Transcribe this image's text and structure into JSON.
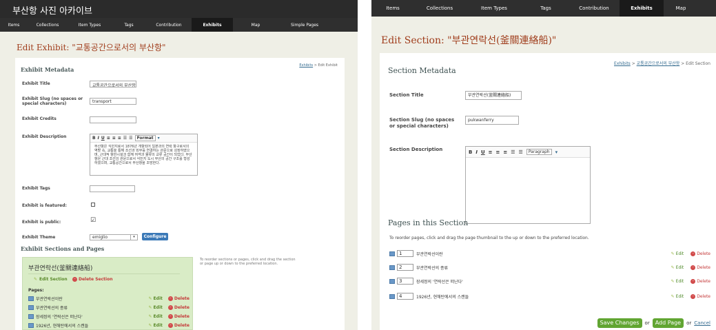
{
  "left": {
    "site_title": "부산항 사진 아카이브",
    "nav": [
      "Items",
      "Collections",
      "Item Types",
      "Tags",
      "Contribution",
      "Exhibits",
      "Map",
      "Simple Pages"
    ],
    "active_nav": "Exhibits",
    "page_title": "Edit Exhibit: \"교통공간으로서의 부산항\"",
    "breadcrumb_link": "Exhibits",
    "breadcrumb_rest": "> Edit Exhibit",
    "metadata_heading": "Exhibit Metadata",
    "fields": {
      "title_label": "Exhibit Title",
      "title_value": "교통공간으로서의 부산항",
      "slug_label": "Exhibit Slug (no spaces or special characters)",
      "slug_value": "transport",
      "credits_label": "Exhibit Credits",
      "credits_value": "",
      "description_label": "Exhibit Description",
      "description_text": "부산항은 식민지로서 1876년 개항되어 일본과의 연락 항구로서의 역할 속, 교통을 통해 조선과 외부를 연결하는 관문으로 성장하였으며, 근대적 항만시설과 함께 여객과 물류의 교류 공간이 되었다. 부산항은 근대 조선의 관문으로서 식민지 도시 부산의 공간 구조를 형성하였으며, 교통공간으로서 부산항을 조망한다.",
      "format_label": "Format",
      "tags_label": "Exhibit Tags",
      "tags_value": "",
      "featured_label": "Exhibit is featured:",
      "featured_mark": "",
      "public_label": "Exhibit is public:",
      "public_mark": "☑",
      "theme_label": "Exhibit Theme",
      "theme_value": "emiglio",
      "configure_label": "Configure"
    },
    "sections_heading": "Exhibit Sections and Pages",
    "section_name": "부관연락선(釜關連絡船)",
    "edit_section": "Edit Section",
    "delete_section": "Delete Section",
    "pages_label": "Pages:",
    "pages": [
      "부관연락선이란",
      "부관연락선의 종류",
      "장세정의 '연락선은 떠난다'",
      "1926년, 현해탄에서의 스캔들"
    ],
    "edit_label": "Edit",
    "delete_label": "Delete",
    "reorder_hint": "To reorder sections or pages, click and drag the section or page up or down to the preferred location."
  },
  "right": {
    "nav": [
      "Items",
      "Collections",
      "Item Types",
      "Tags",
      "Contribution",
      "Exhibits",
      "Map"
    ],
    "active_nav": "Exhibits",
    "page_title": "Edit Section: \"부관연락선(釜關連絡船)\"",
    "breadcrumb_link1": "Exhibits",
    "breadcrumb_link2": "교통공간으로서의 부산항",
    "breadcrumb_rest": "> Edit Section",
    "metadata_heading": "Section Metadata",
    "fields": {
      "title_label": "Section Title",
      "title_value": "부관연락선(釜關連絡船)",
      "slug_label": "Section Slug (no spaces or special characters)",
      "slug_value": "pukwanferry",
      "description_label": "Section Description",
      "paragraph_label": "Paragraph"
    },
    "pages_heading": "Pages in this Section",
    "reorder_hint": "To reorder pages, click and drag the page thumbnail to the up or down to the preferred location.",
    "pages": [
      {
        "num": "1",
        "name": "부관연락선이란"
      },
      {
        "num": "2",
        "name": "부관연락선의 종류"
      },
      {
        "num": "3",
        "name": "장세정의 '연락선은 떠난다'"
      },
      {
        "num": "4",
        "name": "1926년, 현해탄에서의 스캔들"
      }
    ],
    "edit_label": "Edit",
    "delete_label": "Delete",
    "save_label": "Save Changes",
    "or1": "or",
    "add_page_label": "Add Page",
    "or2": "or",
    "cancel_label": "Cancel"
  }
}
